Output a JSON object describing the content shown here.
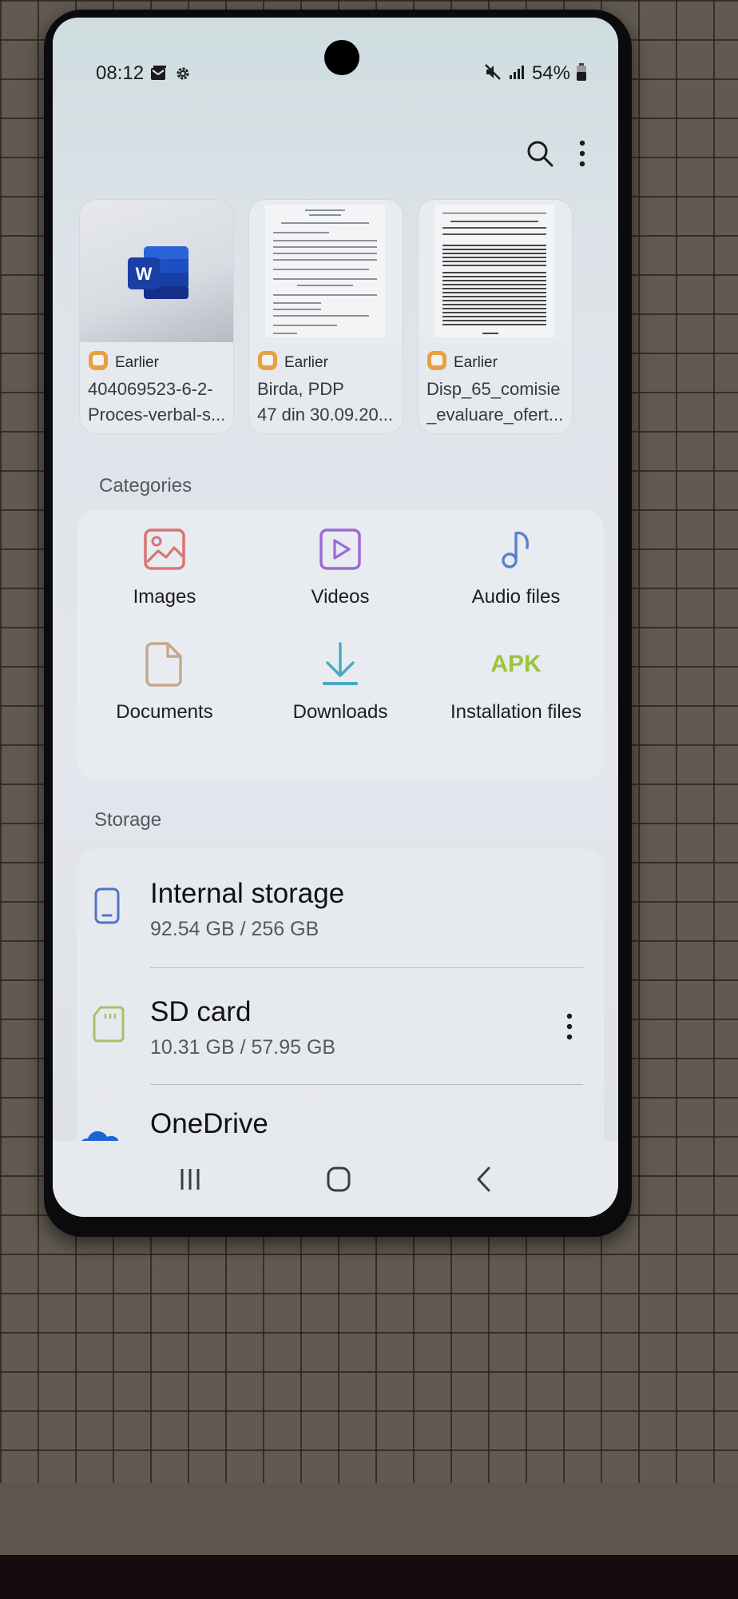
{
  "status_bar": {
    "time": "08:12",
    "left_icons": [
      "email-notification-icon",
      "settings-gear-icon"
    ],
    "right_icons": [
      "mute-icon",
      "signal-icon"
    ],
    "battery_percent": "54%"
  },
  "toolbar": {
    "search_icon": "search-icon",
    "more_icon": "more-options-icon"
  },
  "recent_files": [
    {
      "thumbnail": "word-document-icon",
      "tag": "Earlier",
      "name_line1": "404069523-6-2-",
      "name_line2": "Proces-verbal-s..."
    },
    {
      "thumbnail": "document-preview",
      "tag": "Earlier",
      "name_line1": "Birda, PDP",
      "name_line2": "47 din 30.09.20..."
    },
    {
      "thumbnail": "document-preview",
      "tag": "Earlier",
      "name_line1": "Disp_65_comisie",
      "name_line2": "_evaluare_ofert..."
    }
  ],
  "categories": {
    "title": "Categories",
    "items": [
      {
        "label": "Images",
        "icon": "image-icon",
        "color": "#d87474"
      },
      {
        "label": "Videos",
        "icon": "video-icon",
        "color": "#9a6bd4"
      },
      {
        "label": "Audio files",
        "icon": "music-note-icon",
        "color": "#5a7fd0"
      },
      {
        "label": "Documents",
        "icon": "document-icon",
        "color": "#c4a98a"
      },
      {
        "label": "Downloads",
        "icon": "download-icon",
        "color": "#4aa8c0"
      },
      {
        "label": "Installation files",
        "icon": "apk-icon",
        "icon_text": "APK",
        "color": "#9cc43c"
      }
    ]
  },
  "storage": {
    "title": "Storage",
    "items": [
      {
        "name": "Internal storage",
        "size": "92.54 GB / 256 GB",
        "icon": "phone-icon",
        "color": "#4e74c4"
      },
      {
        "name": "SD card",
        "size": "10.31 GB / 57.95 GB",
        "icon": "sd-card-icon",
        "color": "#a9c06a"
      },
      {
        "name": "OneDrive",
        "icon": "onedrive-cloud-icon",
        "color": "#1e63d6"
      }
    ]
  },
  "nav_bar": {
    "recents": "recent-apps-icon",
    "home": "home-icon",
    "back": "back-icon"
  }
}
